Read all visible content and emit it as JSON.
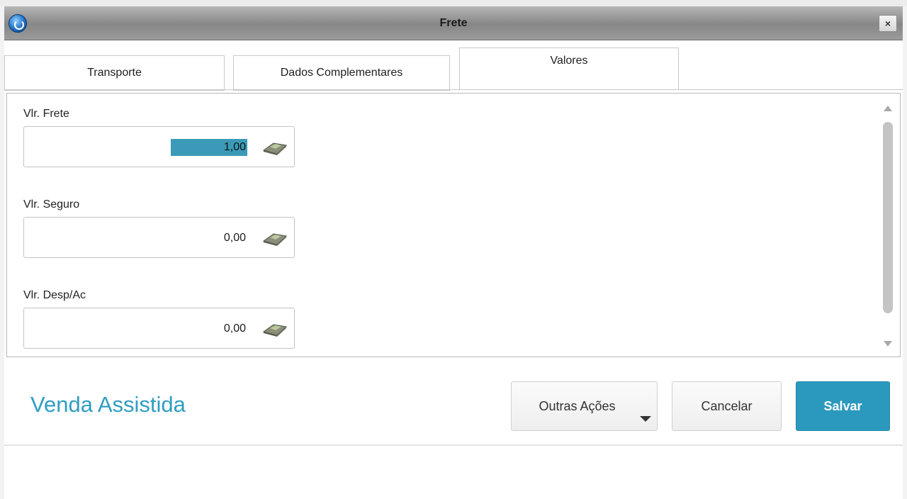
{
  "window": {
    "title": "Frete"
  },
  "tabs": [
    {
      "label": "Transporte",
      "active": false
    },
    {
      "label": "Dados Complementares",
      "active": false
    },
    {
      "label": "Valores",
      "active": true
    }
  ],
  "fields": [
    {
      "label": "Vlr. Frete",
      "value": "1,00",
      "selected": true,
      "icon": "calculator-icon"
    },
    {
      "label": "Vlr. Seguro",
      "value": "0,00",
      "selected": false,
      "icon": "calculator-icon"
    },
    {
      "label": "Vlr. Desp/Ac",
      "value": "0,00",
      "selected": false,
      "icon": "calculator-icon"
    }
  ],
  "footer": {
    "brand": "Venda Assistida",
    "buttons": {
      "other_actions": "Outras Ações",
      "cancel": "Cancelar",
      "save": "Salvar"
    }
  },
  "colors": {
    "accent": "#2b99bd",
    "selection": "#3b9ab7",
    "brand_text": "#2f9dc2"
  }
}
